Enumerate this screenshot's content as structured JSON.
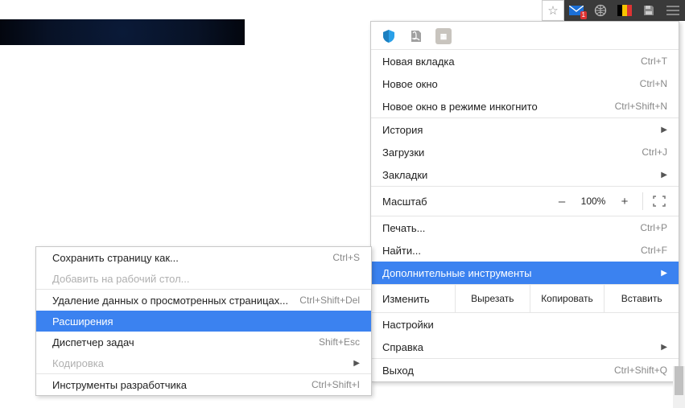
{
  "toolbar": {
    "mail_badge": "1"
  },
  "main_menu": {
    "new_tab": {
      "label": "Новая вкладка",
      "shortcut": "Ctrl+T"
    },
    "new_window": {
      "label": "Новое окно",
      "shortcut": "Ctrl+N"
    },
    "incognito": {
      "label": "Новое окно в режиме инкогнито",
      "shortcut": "Ctrl+Shift+N"
    },
    "history": {
      "label": "История"
    },
    "downloads": {
      "label": "Загрузки",
      "shortcut": "Ctrl+J"
    },
    "bookmarks": {
      "label": "Закладки"
    },
    "zoom": {
      "label": "Масштаб",
      "minus": "–",
      "value": "100%",
      "plus": "+"
    },
    "print": {
      "label": "Печать...",
      "shortcut": "Ctrl+P"
    },
    "find": {
      "label": "Найти...",
      "shortcut": "Ctrl+F"
    },
    "more_tools": {
      "label": "Дополнительные инструменты"
    },
    "edit": {
      "label": "Изменить",
      "cut": "Вырезать",
      "copy": "Копировать",
      "paste": "Вставить"
    },
    "settings": {
      "label": "Настройки"
    },
    "help": {
      "label": "Справка"
    },
    "exit": {
      "label": "Выход",
      "shortcut": "Ctrl+Shift+Q"
    }
  },
  "submenu": {
    "save_page": {
      "label": "Сохранить страницу как...",
      "shortcut": "Ctrl+S"
    },
    "add_desktop": {
      "label": "Добавить на рабочий стол..."
    },
    "clear_data": {
      "label": "Удаление данных о просмотренных страницах...",
      "shortcut": "Ctrl+Shift+Del"
    },
    "extensions": {
      "label": "Расширения"
    },
    "task_manager": {
      "label": "Диспетчер задач",
      "shortcut": "Shift+Esc"
    },
    "encoding": {
      "label": "Кодировка"
    },
    "dev_tools": {
      "label": "Инструменты разработчика",
      "shortcut": "Ctrl+Shift+I"
    }
  }
}
